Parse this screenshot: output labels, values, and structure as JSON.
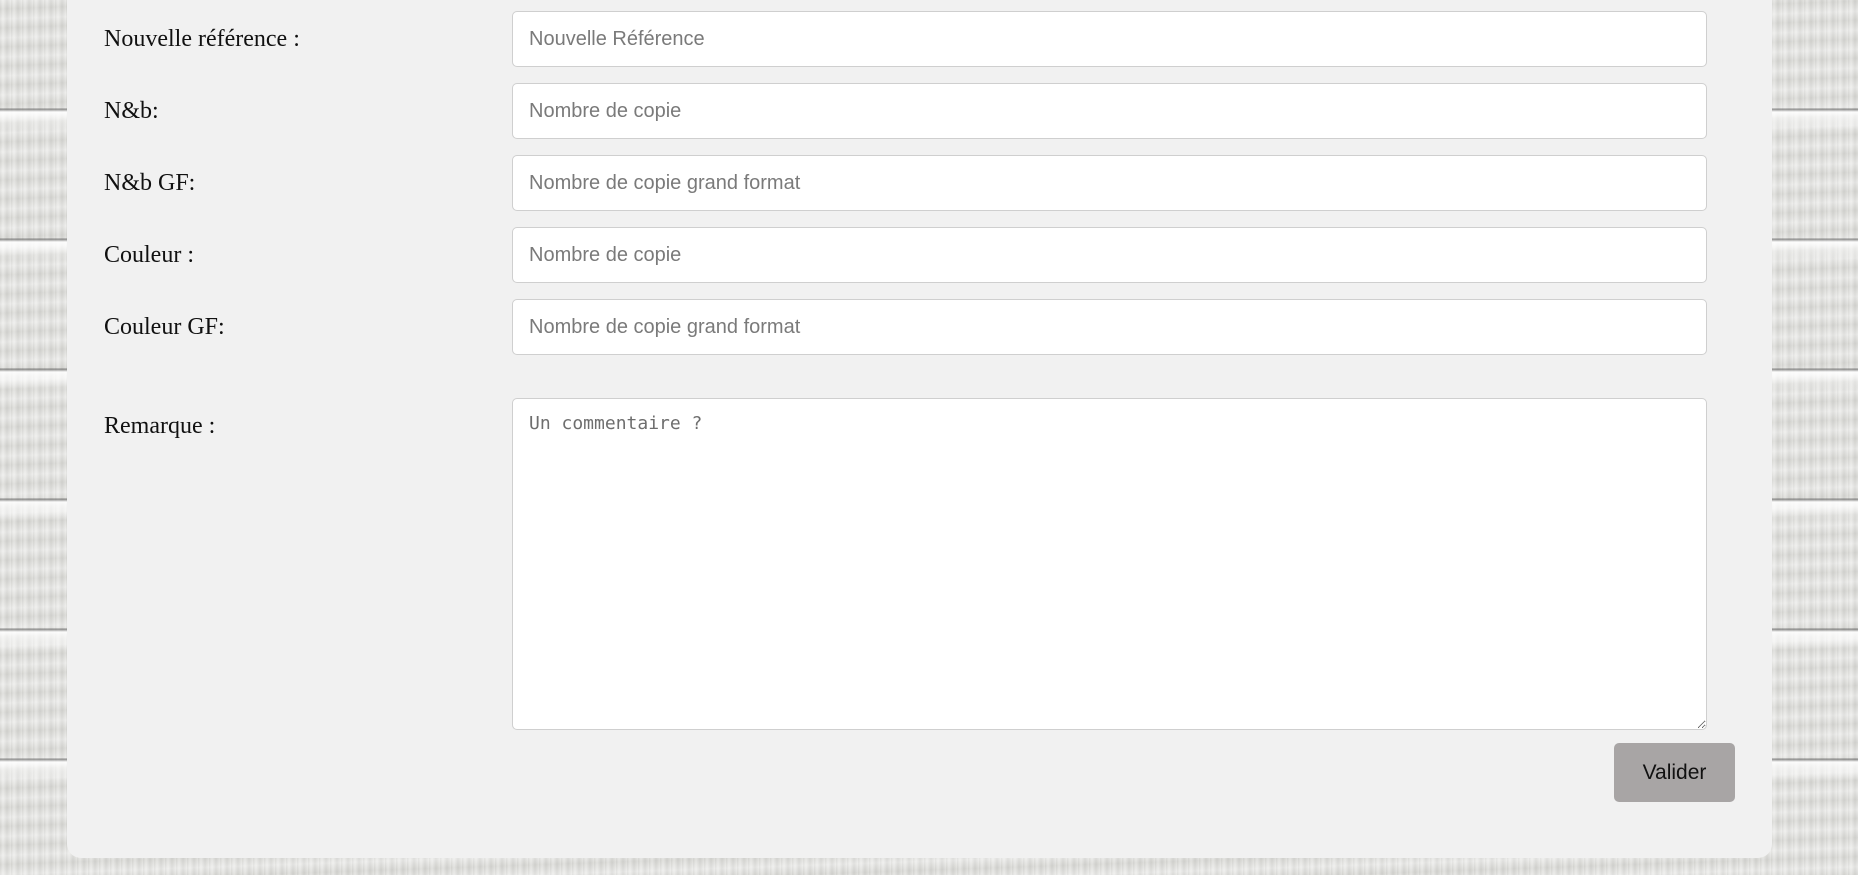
{
  "form": {
    "fields": [
      {
        "label": "Nouvelle référence :",
        "placeholder": "Nouvelle Référence"
      },
      {
        "label": "N&b:",
        "placeholder": "Nombre de copie"
      },
      {
        "label": "N&b GF:",
        "placeholder": "Nombre de copie grand format"
      },
      {
        "label": "Couleur :",
        "placeholder": "Nombre de copie"
      },
      {
        "label": "Couleur GF:",
        "placeholder": "Nombre de copie grand format"
      }
    ],
    "remark": {
      "label": "Remarque :",
      "placeholder": "Un commentaire ?"
    },
    "submit_label": "Valider"
  },
  "colors": {
    "panel_background": "#f1f1f1",
    "button_background": "#a8a5a5"
  }
}
